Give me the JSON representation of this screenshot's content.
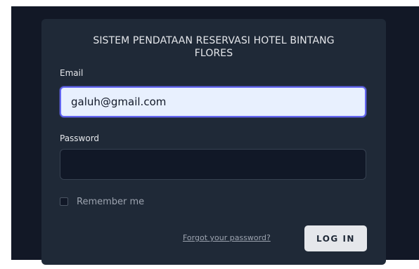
{
  "login_card": {
    "title": "SISTEM PENDATAAN RESERVASI HOTEL BINTANG FLORES",
    "email_label": "Email",
    "email_value": "galuh@gmail.com",
    "password_label": "Password",
    "password_value": "",
    "remember_label": "Remember me",
    "forgot_link": "Forgot your password?",
    "login_button": "LOG IN"
  },
  "colors": {
    "screen_background": "#121826",
    "card_background": "#1f2937",
    "focus_accent": "#6366f1",
    "button_background": "#e5e7eb"
  }
}
